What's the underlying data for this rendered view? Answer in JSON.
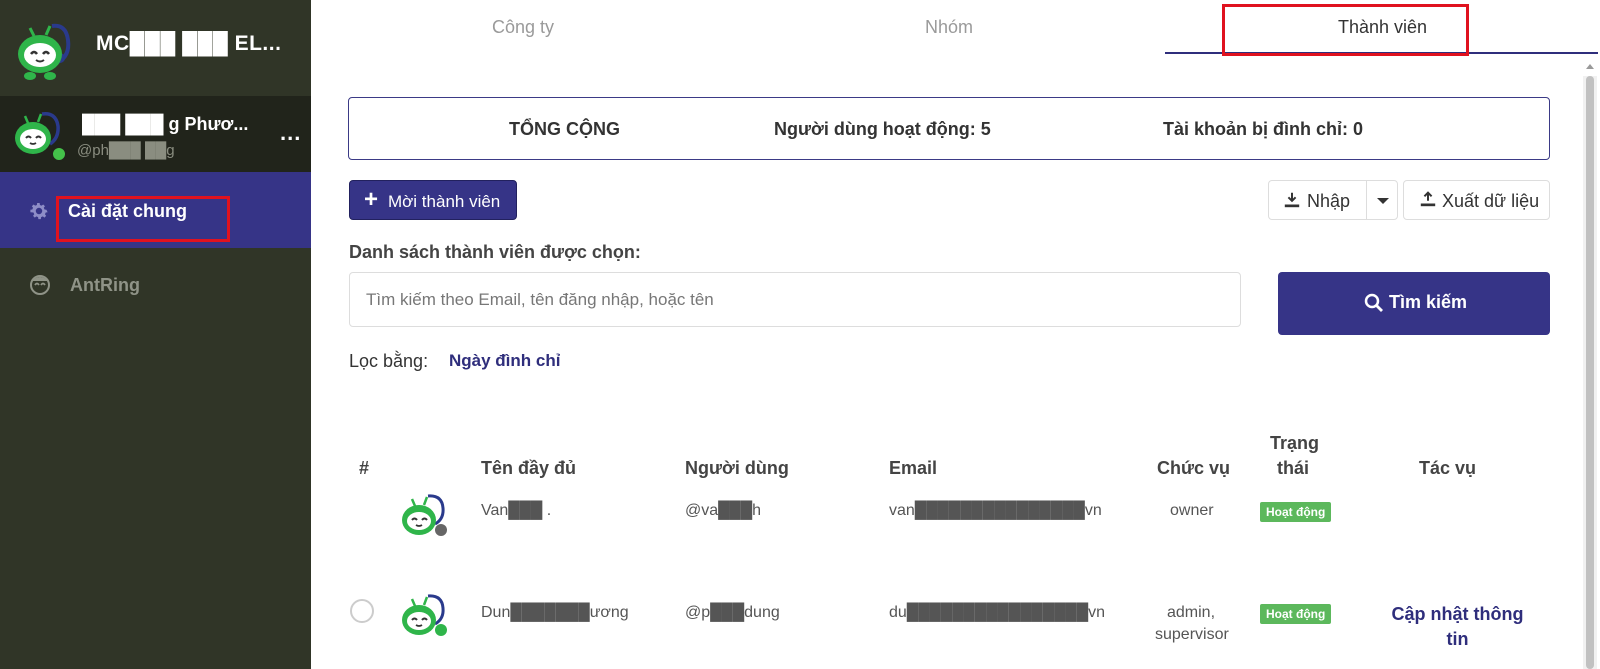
{
  "sidebar": {
    "org_name": "MC███ ███ EL...",
    "user": {
      "name": "███ ███ g Phươ...",
      "handle": "@ph███ ██g",
      "more": "..."
    },
    "items": [
      {
        "label": "Cài đặt chung",
        "icon": "gear-icon",
        "active": true
      },
      {
        "label": "AntRing",
        "icon": "antring-icon",
        "active": false
      }
    ]
  },
  "tabs": [
    {
      "label": "Công ty"
    },
    {
      "label": "Nhóm"
    },
    {
      "label": "Thành viên",
      "active": true
    }
  ],
  "summary": {
    "total_label": "TỔNG CỘNG",
    "active_users": "Người dùng hoạt động: 5",
    "suspended": "Tài khoản bị đình chỉ: 0"
  },
  "toolbar": {
    "invite_label": "Mời thành viên",
    "import_label": "Nhập",
    "export_label": "Xuất dữ liệu"
  },
  "selected_members_label": "Danh sách thành viên được chọn:",
  "search": {
    "placeholder": "Tìm kiếm theo Email, tên đăng nhập, hoặc tên",
    "button_label": "Tìm kiếm"
  },
  "filter": {
    "label": "Lọc bằng:",
    "value": "Ngày đình chỉ"
  },
  "table": {
    "headers": {
      "index": "#",
      "full_name": "Tên đầy đủ",
      "username": "Người dùng",
      "email": "Email",
      "role": "Chức vụ",
      "status_line1": "Trạng",
      "status_line2": "thái",
      "actions": "Tác vụ"
    },
    "rows": [
      {
        "full_name": "Van███ .",
        "username": "@va███h",
        "email": "van███████████████vn",
        "role_line1": "owner",
        "role_line2": "",
        "status": "Hoạt động",
        "action_line1": "",
        "action_line2": ""
      },
      {
        "full_name": "Dun███████ương",
        "username": "@p███dung",
        "email": "du████████████████vn",
        "role_line1": "admin,",
        "role_line2": "supervisor",
        "status": "Hoạt động",
        "action_line1": "Cập nhật thông",
        "action_line2": "tin"
      }
    ]
  },
  "colors": {
    "sidebar_bg": "#303527",
    "accent": "#363487",
    "status_green": "#5cb85c",
    "highlight_red": "#e0121f"
  }
}
